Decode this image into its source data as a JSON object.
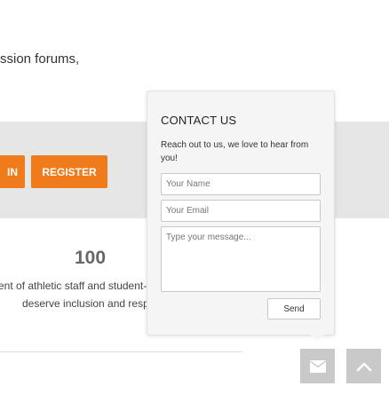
{
  "page": {
    "intro_text": "ssion forums,",
    "login_label": "IN",
    "register_label": "REGISTER",
    "stat_number": "100",
    "stat_line1": "ent of athletic staff and student-",
    "stat_line2": "deserve inclusion and respo"
  },
  "contact": {
    "title": "CONTACT US",
    "description": "Reach out to us, we love to hear from you!",
    "name_placeholder": "Your Name",
    "email_placeholder": "Your Email",
    "message_placeholder": "Type your message...",
    "send_label": "Send"
  },
  "widgets": {
    "mail_icon": "envelope-icon",
    "top_icon": "chevron-up-icon"
  },
  "colors": {
    "accent": "#ef7b1b",
    "band": "#e6e6e6",
    "fab": "#c9c9c9"
  }
}
